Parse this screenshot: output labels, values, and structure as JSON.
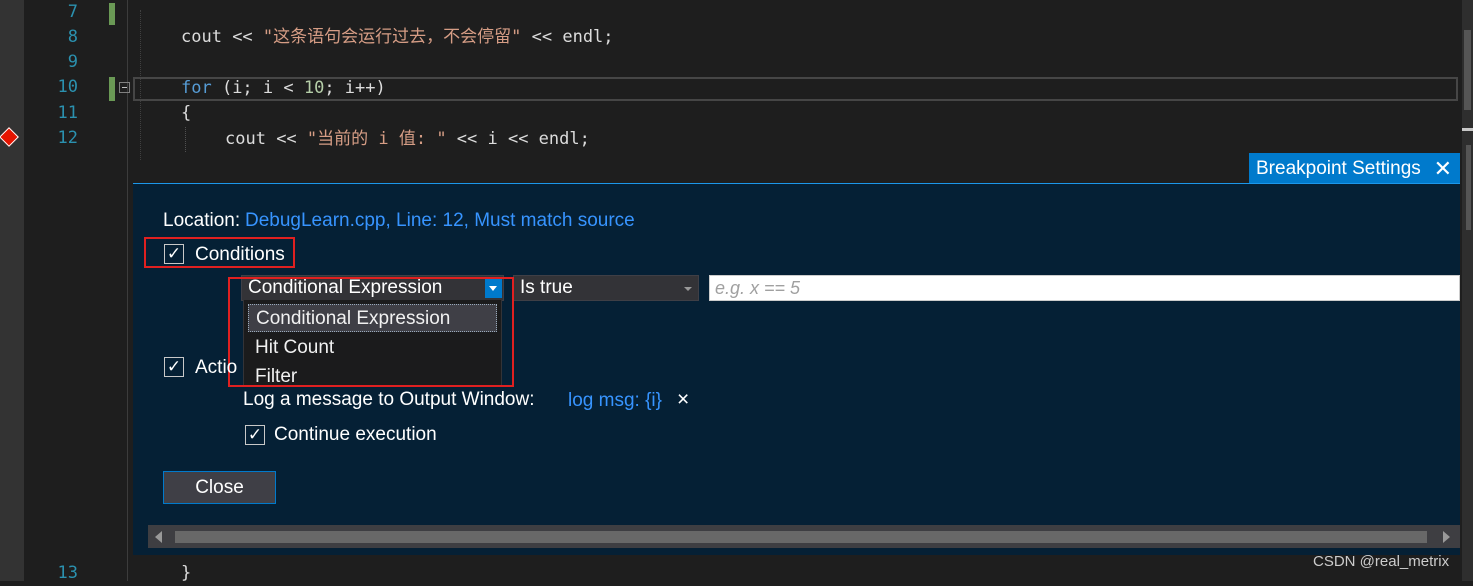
{
  "editor": {
    "line_numbers": [
      "7",
      "8",
      "9",
      "10",
      "11",
      "12",
      "13"
    ],
    "line8": {
      "fn": "cout",
      "op1": " << ",
      "str": "\"这条语句会运行过去，不会停留\"",
      "op2": " << ",
      "end": "endl;"
    },
    "line10": {
      "kw": "for",
      "p1": " (i; i < ",
      "num": "10",
      "p2": "; i++)"
    },
    "line11": "{",
    "line12": {
      "fn": "cout",
      "op1": " << ",
      "str": "\"当前的 i 值: \"",
      "rest": " << i << endl;"
    },
    "line13": "}"
  },
  "breakpoint_settings": {
    "tab_title": "Breakpoint Settings",
    "close_glyph": "✕",
    "location_label": "Location:",
    "location_value": "DebugLearn.cpp, Line: 12, Must match source",
    "conditions_label": "Conditions",
    "conditions_checked": true,
    "condition_type_selected": "Conditional Expression",
    "condition_type_options": [
      "Conditional Expression",
      "Hit Count",
      "Filter"
    ],
    "condition_op_selected": "Is true",
    "condition_placeholder": "e.g. x == 5",
    "actions_label": "Actions",
    "actions_label_visible": "Actio",
    "actions_checked": true,
    "log_label": "Log a message to Output Window:",
    "log_value": "log msg: {i}",
    "log_remove_glyph": "×",
    "continue_label": "Continue execution",
    "continue_checked": true,
    "close_button": "Close",
    "check_glyph": "✓"
  },
  "watermark": "CSDN @real_metrix",
  "colors": {
    "background": "#1e1e1e",
    "panel": "#052035",
    "accent": "#007acc",
    "highlight_box": "#e02020",
    "breakpoint": "#e51400"
  }
}
